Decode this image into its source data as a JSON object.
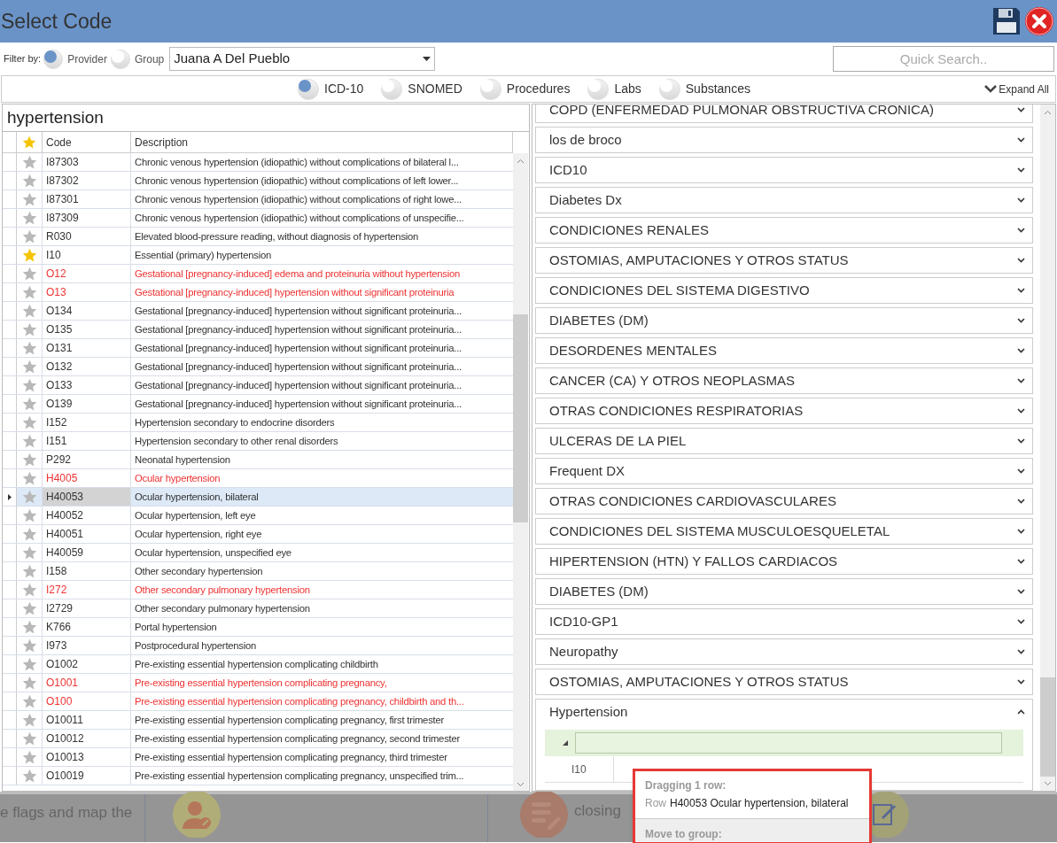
{
  "window": {
    "title": "Select Code"
  },
  "filter": {
    "label": "Filter by:",
    "options": [
      {
        "label": "Provider",
        "selected": true
      },
      {
        "label": "Group",
        "selected": false
      }
    ],
    "provider": "Juana A Del Pueblo"
  },
  "quick_search": {
    "placeholder": "Quick Search.."
  },
  "code_types": [
    {
      "label": "ICD-10",
      "selected": true
    },
    {
      "label": "SNOMED",
      "selected": false
    },
    {
      "label": "Procedures",
      "selected": false
    },
    {
      "label": "Labs",
      "selected": false
    },
    {
      "label": "Substances",
      "selected": false
    }
  ],
  "expand_all": "Expand All",
  "search": {
    "value": "hypertension"
  },
  "table": {
    "columns": [
      "Code",
      "Description"
    ],
    "rows": [
      {
        "code": "I87303",
        "description": "Chronic venous hypertension (idiopathic) without complications of bilateral l...",
        "starred": false,
        "flagged": false,
        "selected": false
      },
      {
        "code": "I87302",
        "description": "Chronic venous hypertension (idiopathic) without complications of left lower...",
        "starred": false,
        "flagged": false,
        "selected": false
      },
      {
        "code": "I87301",
        "description": "Chronic venous hypertension (idiopathic) without complications of right lowe...",
        "starred": false,
        "flagged": false,
        "selected": false
      },
      {
        "code": "I87309",
        "description": "Chronic venous hypertension (idiopathic) without complications of unspecifie...",
        "starred": false,
        "flagged": false,
        "selected": false
      },
      {
        "code": "R030",
        "description": "Elevated blood-pressure reading, without diagnosis of hypertension",
        "starred": false,
        "flagged": false,
        "selected": false
      },
      {
        "code": "I10",
        "description": "Essential (primary) hypertension",
        "starred": true,
        "flagged": false,
        "selected": false
      },
      {
        "code": "O12",
        "description": "Gestational [pregnancy-induced] edema and proteinuria without hypertension",
        "starred": false,
        "flagged": true,
        "selected": false
      },
      {
        "code": "O13",
        "description": "Gestational [pregnancy-induced] hypertension without significant proteinuria",
        "starred": false,
        "flagged": true,
        "selected": false
      },
      {
        "code": "O134",
        "description": "Gestational [pregnancy-induced] hypertension without significant proteinuria...",
        "starred": false,
        "flagged": false,
        "selected": false
      },
      {
        "code": "O135",
        "description": "Gestational [pregnancy-induced] hypertension without significant proteinuria...",
        "starred": false,
        "flagged": false,
        "selected": false
      },
      {
        "code": "O131",
        "description": "Gestational [pregnancy-induced] hypertension without significant proteinuria...",
        "starred": false,
        "flagged": false,
        "selected": false
      },
      {
        "code": "O132",
        "description": "Gestational [pregnancy-induced] hypertension without significant proteinuria...",
        "starred": false,
        "flagged": false,
        "selected": false
      },
      {
        "code": "O133",
        "description": "Gestational [pregnancy-induced] hypertension without significant proteinuria...",
        "starred": false,
        "flagged": false,
        "selected": false
      },
      {
        "code": "O139",
        "description": "Gestational [pregnancy-induced] hypertension without significant proteinuria...",
        "starred": false,
        "flagged": false,
        "selected": false
      },
      {
        "code": "I152",
        "description": "Hypertension secondary to endocrine disorders",
        "starred": false,
        "flagged": false,
        "selected": false
      },
      {
        "code": "I151",
        "description": "Hypertension secondary to other renal disorders",
        "starred": false,
        "flagged": false,
        "selected": false
      },
      {
        "code": "P292",
        "description": "Neonatal hypertension",
        "starred": false,
        "flagged": false,
        "selected": false
      },
      {
        "code": "H4005",
        "description": "Ocular hypertension",
        "starred": false,
        "flagged": true,
        "selected": false
      },
      {
        "code": "H40053",
        "description": "Ocular hypertension, bilateral",
        "starred": false,
        "flagged": false,
        "selected": true
      },
      {
        "code": "H40052",
        "description": "Ocular hypertension, left eye",
        "starred": false,
        "flagged": false,
        "selected": false
      },
      {
        "code": "H40051",
        "description": "Ocular hypertension, right eye",
        "starred": false,
        "flagged": false,
        "selected": false
      },
      {
        "code": "H40059",
        "description": "Ocular hypertension, unspecified eye",
        "starred": false,
        "flagged": false,
        "selected": false
      },
      {
        "code": "I158",
        "description": "Other secondary hypertension",
        "starred": false,
        "flagged": false,
        "selected": false
      },
      {
        "code": "I272",
        "description": "Other secondary pulmonary hypertension",
        "starred": false,
        "flagged": true,
        "selected": false
      },
      {
        "code": "I2729",
        "description": "Other secondary pulmonary hypertension",
        "starred": false,
        "flagged": false,
        "selected": false
      },
      {
        "code": "K766",
        "description": "Portal hypertension",
        "starred": false,
        "flagged": false,
        "selected": false
      },
      {
        "code": "I973",
        "description": "Postprocedural hypertension",
        "starred": false,
        "flagged": false,
        "selected": false
      },
      {
        "code": "O1002",
        "description": "Pre-existing essential hypertension complicating childbirth",
        "starred": false,
        "flagged": false,
        "selected": false
      },
      {
        "code": "O1001",
        "description": "Pre-existing essential hypertension complicating pregnancy,",
        "starred": false,
        "flagged": true,
        "selected": false
      },
      {
        "code": "O100",
        "description": "Pre-existing essential hypertension complicating pregnancy, childbirth and th...",
        "starred": false,
        "flagged": true,
        "selected": false
      },
      {
        "code": "O10011",
        "description": "Pre-existing essential hypertension complicating pregnancy, first trimester",
        "starred": false,
        "flagged": false,
        "selected": false
      },
      {
        "code": "O10012",
        "description": "Pre-existing essential hypertension complicating pregnancy, second trimester",
        "starred": false,
        "flagged": false,
        "selected": false
      },
      {
        "code": "O10013",
        "description": "Pre-existing essential hypertension complicating pregnancy, third trimester",
        "starred": false,
        "flagged": false,
        "selected": false
      },
      {
        "code": "O10019",
        "description": "Pre-existing essential hypertension complicating pregnancy, unspecified trim...",
        "starred": false,
        "flagged": false,
        "selected": false
      }
    ]
  },
  "groups": [
    {
      "name": "COPD (ENFERMEDAD PULMONAR OBSTRUCTIVA CRONICA)",
      "expanded": false
    },
    {
      "name": "los de broco",
      "expanded": false
    },
    {
      "name": "ICD10",
      "expanded": false
    },
    {
      "name": "Diabetes Dx",
      "expanded": false
    },
    {
      "name": "CONDICIONES RENALES",
      "expanded": false
    },
    {
      "name": "OSTOMIAS, AMPUTACIONES Y OTROS STATUS",
      "expanded": false
    },
    {
      "name": "CONDICIONES DEL SISTEMA DIGESTIVO",
      "expanded": false
    },
    {
      "name": "DIABETES (DM)",
      "expanded": false
    },
    {
      "name": "DESORDENES MENTALES",
      "expanded": false
    },
    {
      "name": "CANCER (CA) Y OTROS NEOPLASMAS",
      "expanded": false
    },
    {
      "name": "OTRAS CONDICIONES RESPIRATORIAS",
      "expanded": false
    },
    {
      "name": "ULCERAS DE LA PIEL",
      "expanded": false
    },
    {
      "name": "Frequent DX",
      "expanded": false
    },
    {
      "name": "OTRAS CONDICIONES CARDIOVASCULARES",
      "expanded": false
    },
    {
      "name": "CONDICIONES DEL SISTEMA MUSCULOESQUELETAL",
      "expanded": false
    },
    {
      "name": "HIPERTENSION (HTN) Y FALLOS CARDIACOS",
      "expanded": false
    },
    {
      "name": "DIABETES (DM)",
      "expanded": false
    },
    {
      "name": "ICD10-GP1",
      "expanded": false
    },
    {
      "name": "Neuropathy",
      "expanded": false
    },
    {
      "name": "OSTOMIAS, AMPUTACIONES Y OTROS STATUS",
      "expanded": false
    },
    {
      "name": "Hypertension",
      "expanded": true,
      "rows": [
        {
          "code": "I10"
        }
      ]
    }
  ],
  "drag_tooltip": {
    "title": "Dragging 1 row:",
    "row_prefix": "Row",
    "row_text": "H40053 Ocular hypertension, bilateral",
    "section": "Move to group:"
  },
  "background": {
    "texts": [
      "e flags and map the",
      "closing"
    ]
  }
}
